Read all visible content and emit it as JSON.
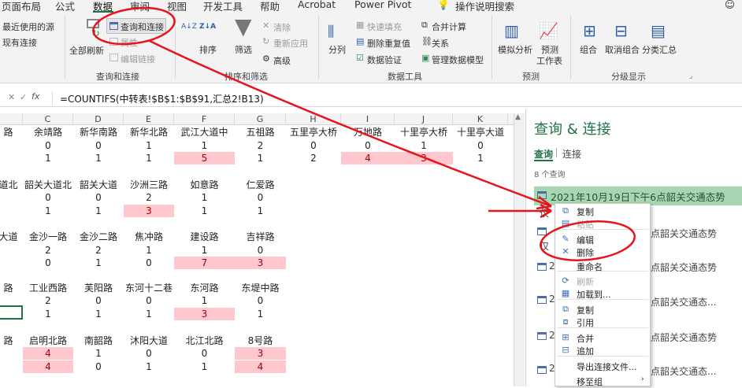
{
  "tabs": [
    "页面布局",
    "公式",
    "数据",
    "审阅",
    "视图",
    "开发工具",
    "帮助",
    "Acrobat",
    "Power Pivot"
  ],
  "tell_me": "操作说明搜索",
  "ribbon": {
    "get_data": {
      "recent_sources": "最近使用的源",
      "existing": "现有连接"
    },
    "queries": {
      "refresh_all": "全部刷新",
      "queries_connections": "查询和连接",
      "properties": "属性",
      "edit_links": "编辑链接",
      "group_label": "查询和连接"
    },
    "sort": {
      "sort": "排序",
      "filter": "筛选",
      "clear": "清除",
      "reapply": "重新应用",
      "advanced": "高级",
      "group_label": "排序和筛选",
      "az": "A↓Z",
      "za": "Z↓A"
    },
    "data_tools": {
      "split": "分列",
      "flash_fill": "快速填充",
      "remove_dup": "删除重复值",
      "validation": "数据验证",
      "merge_calc": "合并计算",
      "relations": "关系",
      "manage_model": "管理数据模型",
      "group_label": "数据工具"
    },
    "forecast": {
      "what_if": "模拟分析",
      "forecast_sheet": "预测",
      "forecast_sheet2": "工作表",
      "group_label": "预测"
    },
    "outline": {
      "group": "组合",
      "ungroup": "取消组合",
      "subtotal": "分类汇总",
      "group_label": "分级显示"
    }
  },
  "formula_bar": {
    "cancel": "✕",
    "confirm": "✓",
    "fx": "fx",
    "formula": "=COUNTIFS(中转表!$B$1:$B$91,汇总2!B13)"
  },
  "columns": [
    "C",
    "D",
    "E",
    "F",
    "G",
    "H",
    "I",
    "J",
    "K"
  ],
  "sheet_text": {
    "r0": [
      "路",
      "余靖路",
      "新华南路",
      "新华北路",
      "武江大道中",
      "五祖路",
      "五里亭大桥",
      "万地路",
      "十里亭大桥",
      "十里亭大道"
    ],
    "r1": [
      "0",
      "0",
      "1",
      "1",
      "2",
      "0",
      "0",
      "1",
      "0"
    ],
    "r2": [
      "1",
      "1",
      "1",
      "5",
      "1",
      "2",
      "4",
      "3",
      "1"
    ],
    "r3": [
      "道北",
      "韶关大道北",
      "韶关大道",
      "沙洲三路",
      "如意路",
      "仁爱路"
    ],
    "r4": [
      "0",
      "0",
      "2",
      "1",
      "0"
    ],
    "r5": [
      "1",
      "1",
      "3",
      "1",
      "1"
    ],
    "r6": [
      "大道",
      "金沙一路",
      "金沙二路",
      "焦冲路",
      "建设路",
      "吉祥路"
    ],
    "r7": [
      "2",
      "2",
      "1",
      "1",
      "0"
    ],
    "r8": [
      "0",
      "1",
      "0",
      "7",
      "3"
    ],
    "r9": [
      "路",
      "工业西路",
      "芙阳路",
      "东河十二巷",
      "东河路",
      "东堤中路"
    ],
    "r10": [
      "2",
      "0",
      "0",
      "1",
      "0"
    ],
    "r11": [
      "1",
      "1",
      "1",
      "3",
      "1"
    ],
    "r12": [
      "路",
      "启明北路",
      "南韶路",
      "沐阳大道",
      "北江北路",
      "8号路"
    ],
    "r13": [
      "4",
      "1",
      "0",
      "0",
      "3"
    ],
    "r14": [
      "4",
      "0",
      "1",
      "1",
      "4"
    ]
  },
  "pane": {
    "title": "查询 & 连接",
    "tab_queries": "查询",
    "tab_connections": "连接",
    "count": "8 个查询",
    "items": [
      "2021年10月19日下午6点韶关交通态势",
      "点韶关交通态势",
      "点韶关交通态势",
      "点韶关交通态...",
      "点韶关交通态势",
      "点韶关交通态..."
    ],
    "prefixes": [
      "2(",
      "2(",
      "2(",
      "2(",
      "2("
    ],
    "side_texts": [
      "仅",
      "仅"
    ]
  },
  "context_menu": {
    "items": [
      "复制",
      "粘贴",
      "编辑",
      "删除",
      "重命名",
      "刷新",
      "加载到...",
      "复制",
      "引用",
      "合并",
      "追加",
      "导出连接文件...",
      "移至组"
    ],
    "icons": [
      "⧉",
      "▤",
      "✎",
      "✕",
      "",
      "⟳",
      "▦",
      "⧉",
      "⧈",
      "⊞",
      "⊟",
      "",
      ""
    ]
  },
  "colors": {
    "accent": "#217346",
    "pink_fill": "#ffc7ce",
    "red_text": "#9c0006",
    "annotation": "#e8141c",
    "query_highlight": "#a7d7b2"
  }
}
